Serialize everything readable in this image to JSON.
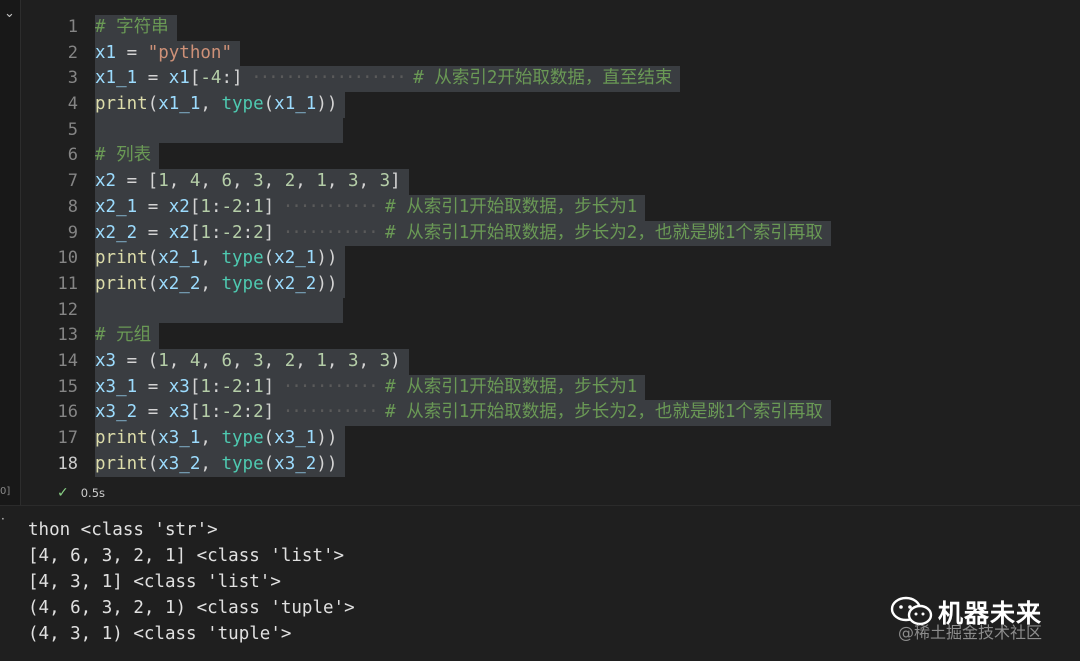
{
  "cell": {
    "exec_count": "0]",
    "lines": [
      {
        "n": "1",
        "tokens": [
          {
            "t": "# 字符串",
            "c": "com"
          }
        ]
      },
      {
        "n": "2",
        "tokens": [
          {
            "t": "x1",
            "c": "var"
          },
          {
            "t": " = ",
            "c": ""
          },
          {
            "t": "\"python\"",
            "c": "str"
          }
        ]
      },
      {
        "n": "3",
        "tokens": [
          {
            "t": "x1_1",
            "c": "var"
          },
          {
            "t": " = ",
            "c": ""
          },
          {
            "t": "x1",
            "c": "var"
          },
          {
            "t": "[",
            "c": ""
          },
          {
            "t": "-4",
            "c": "num"
          },
          {
            "t": ":]",
            "c": ""
          },
          {
            "t": " ·················· ",
            "c": "dots"
          },
          {
            "t": "# 从索引2开始取数据，直至结束",
            "c": "com"
          }
        ]
      },
      {
        "n": "4",
        "tokens": [
          {
            "t": "print",
            "c": "fn"
          },
          {
            "t": "(",
            "c": ""
          },
          {
            "t": "x1_1",
            "c": "var"
          },
          {
            "t": ", ",
            "c": ""
          },
          {
            "t": "type",
            "c": "type"
          },
          {
            "t": "(",
            "c": ""
          },
          {
            "t": "x1_1",
            "c": "var"
          },
          {
            "t": "))",
            "c": ""
          }
        ]
      },
      {
        "n": "5",
        "tokens": []
      },
      {
        "n": "6",
        "tokens": [
          {
            "t": "# 列表",
            "c": "com"
          }
        ]
      },
      {
        "n": "7",
        "tokens": [
          {
            "t": "x2",
            "c": "var"
          },
          {
            "t": " = [",
            "c": ""
          },
          {
            "t": "1",
            "c": "num"
          },
          {
            "t": ", ",
            "c": ""
          },
          {
            "t": "4",
            "c": "num"
          },
          {
            "t": ", ",
            "c": ""
          },
          {
            "t": "6",
            "c": "num"
          },
          {
            "t": ", ",
            "c": ""
          },
          {
            "t": "3",
            "c": "num"
          },
          {
            "t": ", ",
            "c": ""
          },
          {
            "t": "2",
            "c": "num"
          },
          {
            "t": ", ",
            "c": ""
          },
          {
            "t": "1",
            "c": "num"
          },
          {
            "t": ", ",
            "c": ""
          },
          {
            "t": "3",
            "c": "num"
          },
          {
            "t": ", ",
            "c": ""
          },
          {
            "t": "3",
            "c": "num"
          },
          {
            "t": "]",
            "c": ""
          }
        ]
      },
      {
        "n": "8",
        "tokens": [
          {
            "t": "x2_1",
            "c": "var"
          },
          {
            "t": " = ",
            "c": ""
          },
          {
            "t": "x2",
            "c": "var"
          },
          {
            "t": "[",
            "c": ""
          },
          {
            "t": "1",
            "c": "num"
          },
          {
            "t": ":",
            "c": ""
          },
          {
            "t": "-2",
            "c": "num"
          },
          {
            "t": ":",
            "c": ""
          },
          {
            "t": "1",
            "c": "num"
          },
          {
            "t": "]",
            "c": ""
          },
          {
            "t": " ··········· ",
            "c": "dots"
          },
          {
            "t": "# 从索引1开始取数据，步长为1",
            "c": "com"
          }
        ]
      },
      {
        "n": "9",
        "tokens": [
          {
            "t": "x2_2",
            "c": "var"
          },
          {
            "t": " = ",
            "c": ""
          },
          {
            "t": "x2",
            "c": "var"
          },
          {
            "t": "[",
            "c": ""
          },
          {
            "t": "1",
            "c": "num"
          },
          {
            "t": ":",
            "c": ""
          },
          {
            "t": "-2",
            "c": "num"
          },
          {
            "t": ":",
            "c": ""
          },
          {
            "t": "2",
            "c": "num"
          },
          {
            "t": "]",
            "c": ""
          },
          {
            "t": " ··········· ",
            "c": "dots"
          },
          {
            "t": "# 从索引1开始取数据，步长为2，也就是跳1个索引再取",
            "c": "com"
          }
        ]
      },
      {
        "n": "10",
        "tokens": [
          {
            "t": "print",
            "c": "fn"
          },
          {
            "t": "(",
            "c": ""
          },
          {
            "t": "x2_1",
            "c": "var"
          },
          {
            "t": ", ",
            "c": ""
          },
          {
            "t": "type",
            "c": "type"
          },
          {
            "t": "(",
            "c": ""
          },
          {
            "t": "x2_1",
            "c": "var"
          },
          {
            "t": "))",
            "c": ""
          }
        ]
      },
      {
        "n": "11",
        "tokens": [
          {
            "t": "print",
            "c": "fn"
          },
          {
            "t": "(",
            "c": ""
          },
          {
            "t": "x2_2",
            "c": "var"
          },
          {
            "t": ", ",
            "c": ""
          },
          {
            "t": "type",
            "c": "type"
          },
          {
            "t": "(",
            "c": ""
          },
          {
            "t": "x2_2",
            "c": "var"
          },
          {
            "t": "))",
            "c": ""
          }
        ]
      },
      {
        "n": "12",
        "tokens": []
      },
      {
        "n": "13",
        "tokens": [
          {
            "t": "# 元组",
            "c": "com"
          }
        ]
      },
      {
        "n": "14",
        "tokens": [
          {
            "t": "x3",
            "c": "var"
          },
          {
            "t": " = (",
            "c": ""
          },
          {
            "t": "1",
            "c": "num"
          },
          {
            "t": ", ",
            "c": ""
          },
          {
            "t": "4",
            "c": "num"
          },
          {
            "t": ", ",
            "c": ""
          },
          {
            "t": "6",
            "c": "num"
          },
          {
            "t": ", ",
            "c": ""
          },
          {
            "t": "3",
            "c": "num"
          },
          {
            "t": ", ",
            "c": ""
          },
          {
            "t": "2",
            "c": "num"
          },
          {
            "t": ", ",
            "c": ""
          },
          {
            "t": "1",
            "c": "num"
          },
          {
            "t": ", ",
            "c": ""
          },
          {
            "t": "3",
            "c": "num"
          },
          {
            "t": ", ",
            "c": ""
          },
          {
            "t": "3",
            "c": "num"
          },
          {
            "t": ")",
            "c": ""
          }
        ]
      },
      {
        "n": "15",
        "tokens": [
          {
            "t": "x3_1",
            "c": "var"
          },
          {
            "t": " = ",
            "c": ""
          },
          {
            "t": "x3",
            "c": "var"
          },
          {
            "t": "[",
            "c": ""
          },
          {
            "t": "1",
            "c": "num"
          },
          {
            "t": ":",
            "c": ""
          },
          {
            "t": "-2",
            "c": "num"
          },
          {
            "t": ":",
            "c": ""
          },
          {
            "t": "1",
            "c": "num"
          },
          {
            "t": "]",
            "c": ""
          },
          {
            "t": " ··········· ",
            "c": "dots"
          },
          {
            "t": "# 从索引1开始取数据，步长为1",
            "c": "com"
          }
        ]
      },
      {
        "n": "16",
        "tokens": [
          {
            "t": "x3_2",
            "c": "var"
          },
          {
            "t": " = ",
            "c": ""
          },
          {
            "t": "x3",
            "c": "var"
          },
          {
            "t": "[",
            "c": ""
          },
          {
            "t": "1",
            "c": "num"
          },
          {
            "t": ":",
            "c": ""
          },
          {
            "t": "-2",
            "c": "num"
          },
          {
            "t": ":",
            "c": ""
          },
          {
            "t": "2",
            "c": "num"
          },
          {
            "t": "]",
            "c": ""
          },
          {
            "t": " ··········· ",
            "c": "dots"
          },
          {
            "t": "# 从索引1开始取数据，步长为2，也就是跳1个索引再取",
            "c": "com"
          }
        ]
      },
      {
        "n": "17",
        "tokens": [
          {
            "t": "print",
            "c": "fn"
          },
          {
            "t": "(",
            "c": ""
          },
          {
            "t": "x3_1",
            "c": "var"
          },
          {
            "t": ", ",
            "c": ""
          },
          {
            "t": "type",
            "c": "type"
          },
          {
            "t": "(",
            "c": ""
          },
          {
            "t": "x3_1",
            "c": "var"
          },
          {
            "t": "))",
            "c": ""
          }
        ]
      },
      {
        "n": "18",
        "tokens": [
          {
            "t": "print",
            "c": "fn"
          },
          {
            "t": "(",
            "c": ""
          },
          {
            "t": "x3_2",
            "c": "var"
          },
          {
            "t": ", ",
            "c": ""
          },
          {
            "t": "type",
            "c": "type"
          },
          {
            "t": "(",
            "c": ""
          },
          {
            "t": "x3_2",
            "c": "var"
          },
          {
            "t": "))",
            "c": ""
          }
        ]
      }
    ],
    "active_line": "18",
    "status": {
      "icon": "check-icon",
      "duration": "0.5s"
    }
  },
  "output": {
    "lines": [
      "thon <class 'str'>",
      "[4, 6, 3, 2, 1] <class 'list'>",
      "[4, 3, 1] <class 'list'>",
      "(4, 6, 3, 2, 1) <class 'tuple'>",
      "(4, 3, 1) <class 'tuple'>"
    ]
  },
  "watermark": {
    "icon": "wechat-icon",
    "brand": "机器未来",
    "credit": "@稀土掘金技术社区"
  },
  "colors": {
    "background": "#1f1f1f",
    "selection": "#3a3d41",
    "comment": "#6a9955",
    "string": "#ce9178",
    "variable": "#9cdcfe",
    "function": "#dcdcaa",
    "type": "#4ec9b0",
    "number": "#b5cea8",
    "success": "#89d185"
  }
}
